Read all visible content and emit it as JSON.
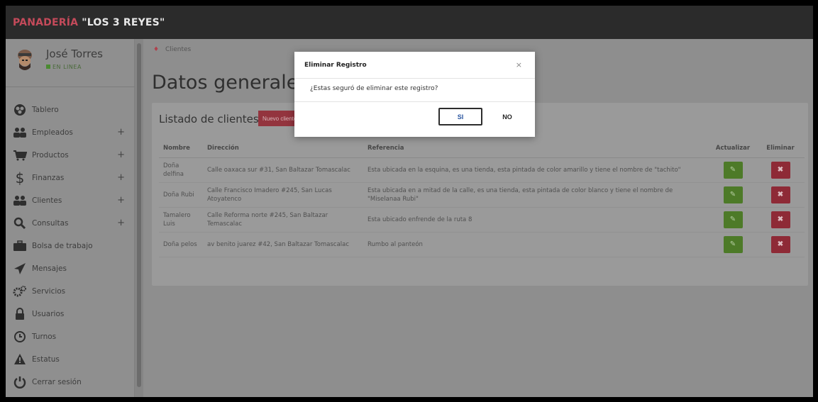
{
  "brand": {
    "part1": "PANADERÍA",
    "part2": "\"LOS 3 REYES\""
  },
  "user": {
    "name": "José Torres",
    "status": "EN LINEA"
  },
  "menu": [
    {
      "label": "Tablero",
      "icon": "dashboard-icon",
      "plus": ""
    },
    {
      "label": "Empleados",
      "icon": "users-icon",
      "plus": "+"
    },
    {
      "label": "Productos",
      "icon": "cart-icon",
      "plus": "+"
    },
    {
      "label": "Finanzas",
      "icon": "dollar-icon",
      "plus": "+"
    },
    {
      "label": "Clientes",
      "icon": "users-icon",
      "plus": "+"
    },
    {
      "label": "Consultas",
      "icon": "search-icon",
      "plus": "+"
    },
    {
      "label": "Bolsa de trabajo",
      "icon": "briefcase-icon",
      "plus": ""
    },
    {
      "label": "Mensajes",
      "icon": "send-icon",
      "plus": ""
    },
    {
      "label": "Servicios",
      "icon": "gears-icon",
      "plus": ""
    },
    {
      "label": "Usuarios",
      "icon": "user-lock-icon",
      "plus": ""
    },
    {
      "label": "Turnos",
      "icon": "clock-icon",
      "plus": ""
    },
    {
      "label": "Estatus",
      "icon": "warning-icon",
      "plus": ""
    },
    {
      "label": "Cerrar sesión",
      "icon": "power-icon",
      "plus": ""
    }
  ],
  "breadcrumb": {
    "current": "Clientes"
  },
  "page": {
    "title": "Datos generales"
  },
  "card": {
    "title": "Listado de clientes",
    "new_button": "Nuevo cliente"
  },
  "table": {
    "headers": [
      "Nombre",
      "Dirección",
      "Referencia",
      "Actualizar",
      "Eliminar"
    ],
    "rows": [
      {
        "nombre": "Doña delfina",
        "direccion": "Calle oaxaca sur #31, San Baltazar Tomascalac",
        "referencia": "Esta ubicada en la esquina, es una tienda, esta pintada de color amarillo y tiene el nombre de \"tachito\""
      },
      {
        "nombre": "Doña Rubi",
        "direccion": "Calle Francisco Imadero #245, San Lucas Atoyatenco",
        "referencia": "Esta ubicada en a mitad de la calle, es una tienda, esta pintada de color blanco y tiene el nombre de \"Miselanaa Rubi\""
      },
      {
        "nombre": "Tamalero Luis",
        "direccion": "Calle Reforma norte #245, San Baltazar Temascalac",
        "referencia": "Esta ubicado enfrende de la ruta 8"
      },
      {
        "nombre": "Doña pelos",
        "direccion": "av benito juarez #42, San Baltazar Tomascalac",
        "referencia": "Rumbo al panteón"
      }
    ]
  },
  "modal": {
    "title": "Eliminar Registro",
    "close": "×",
    "message": "¿Estas seguró de eliminar este registro?",
    "confirm": "SI",
    "cancel": "NO"
  },
  "colors": {
    "brand_red": "#c44a5a",
    "edit_green": "#4d7a28",
    "delete_red": "#8e2a36",
    "topbar": "#2b2b2b"
  }
}
